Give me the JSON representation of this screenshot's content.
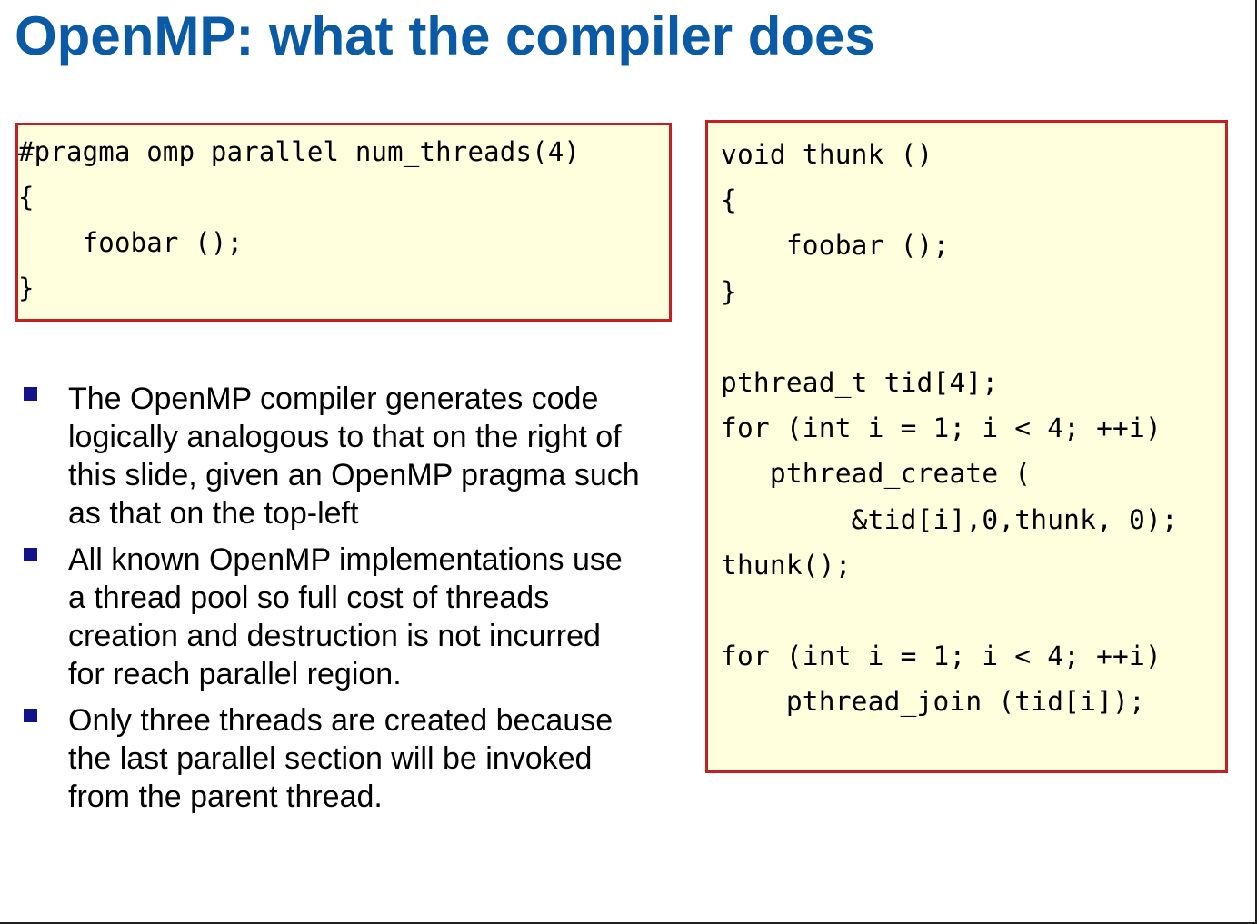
{
  "slide": {
    "title": "OpenMP: what the compiler does"
  },
  "pragma_code": {
    "lines": [
      "#pragma omp parallel num_threads(4)",
      "{",
      "    foobar ();",
      "}"
    ]
  },
  "thunk_code": {
    "lines": [
      "void thunk ()",
      "{",
      "    foobar ();",
      "}",
      "",
      "pthread_t tid[4];",
      "for (int i = 1; i < 4; ++i)",
      "   pthread_create (",
      "        &tid[i],0,thunk, 0);",
      "thunk();",
      "",
      "for (int i = 1; i < 4; ++i)",
      "    pthread_join (tid[i]);"
    ]
  },
  "bullets": [
    {
      "text": "The OpenMP compiler generates code logically analogous to that on the right of this slide, given an OpenMP pragma such as that on the top-left"
    },
    {
      "text": "All known OpenMP implementations use a thread pool so full cost of threads creation and destruction is not incurred for reach parallel region."
    },
    {
      "text": "Only three threads are created because the last parallel section will be invoked from the parent thread."
    }
  ],
  "colors": {
    "title": "#0a5aa5",
    "code_background": "#ffffdd",
    "code_border": "#c41f25",
    "bullet_marker": "#12128a"
  }
}
